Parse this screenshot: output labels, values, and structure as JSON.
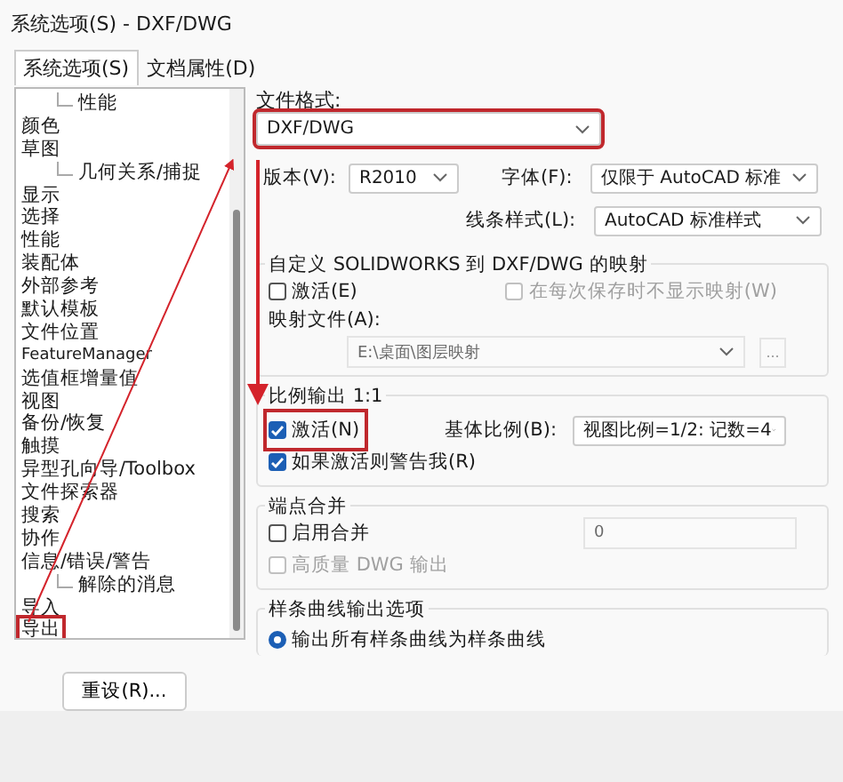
{
  "window": {
    "title": "系统选项(S) - DXF/DWG"
  },
  "tabs": [
    {
      "label": "系统选项(S)",
      "selected": true
    },
    {
      "label": "文档属性(D)",
      "selected": false
    }
  ],
  "tree": [
    {
      "children": [
        {
          "label": "性能",
          "selected": false
        }
      ]
    },
    {
      "label": "颜色",
      "selected": false
    },
    {
      "label": "草图",
      "selected": false,
      "children": [
        {
          "label": "几何关系/捕捉",
          "selected": false
        }
      ]
    },
    {
      "label": "显示",
      "selected": false
    },
    {
      "label": "选择",
      "selected": false
    },
    {
      "label": "性能",
      "selected": false
    },
    {
      "label": "装配体",
      "selected": false
    },
    {
      "label": "外部参考",
      "selected": false
    },
    {
      "label": "默认模板",
      "selected": false
    },
    {
      "label": "文件位置",
      "selected": false
    },
    {
      "label": "FeatureManager",
      "selected": false
    },
    {
      "label": "选值框增量值",
      "selected": false
    },
    {
      "label": "视图",
      "selected": false
    },
    {
      "label": "备份/恢复",
      "selected": false
    },
    {
      "label": "触摸",
      "selected": false
    },
    {
      "label": "异型孔向导/Toolbox",
      "selected": false
    },
    {
      "label": "文件探索器",
      "selected": false
    },
    {
      "label": "搜索",
      "selected": false
    },
    {
      "label": "协作",
      "selected": false
    },
    {
      "label": "信息/错误/警告",
      "selected": false,
      "children": [
        {
          "label": "解除的消息",
          "selected": false
        }
      ]
    },
    {
      "label": "导入",
      "selected": false
    },
    {
      "label": "导出",
      "selected": false,
      "highlighted": true
    }
  ],
  "reset_button": "重设(R)...",
  "file_format": {
    "label": "文件格式:",
    "value": "DXF/DWG",
    "highlighted": true
  },
  "version": {
    "label": "版本(V):",
    "value": "R2010"
  },
  "font": {
    "label": "字体(F):",
    "value": "仅限于 AutoCAD 标准"
  },
  "line_style": {
    "label": "线条样式(L):",
    "value": "AutoCAD 标准样式"
  },
  "mapping": {
    "title": "自定义 SOLIDWORKS 到 DXF/DWG 的映射",
    "activate": {
      "label": "激活(E)",
      "checked": false,
      "disabled": false
    },
    "no_show": {
      "label": "在每次保存时不显示映射(W)",
      "checked": false,
      "disabled": true
    },
    "file_label": "映射文件(A):",
    "file_value": "E:\\桌面\\图层映射",
    "browse": "..."
  },
  "scale": {
    "title": "比例输出 1:1",
    "activate": {
      "label": "激活(N)",
      "checked": true,
      "disabled": false,
      "highlighted": true
    },
    "base_label": "基体比例(B):",
    "base_value": "视图比例=1/2: 记数=4",
    "warn": {
      "label": "如果激活则警告我(R)",
      "checked": true,
      "disabled": false
    }
  },
  "merge": {
    "title": "端点合并",
    "enable": {
      "label": "启用合并",
      "checked": false,
      "disabled": false
    },
    "value": "0",
    "hq": {
      "label": "高质量 DWG 输出",
      "checked": false,
      "disabled": true
    }
  },
  "spline": {
    "title": "样条曲线输出选项",
    "options": [
      {
        "label": "输出所有样条曲线为样条曲线",
        "selected": true
      }
    ]
  }
}
